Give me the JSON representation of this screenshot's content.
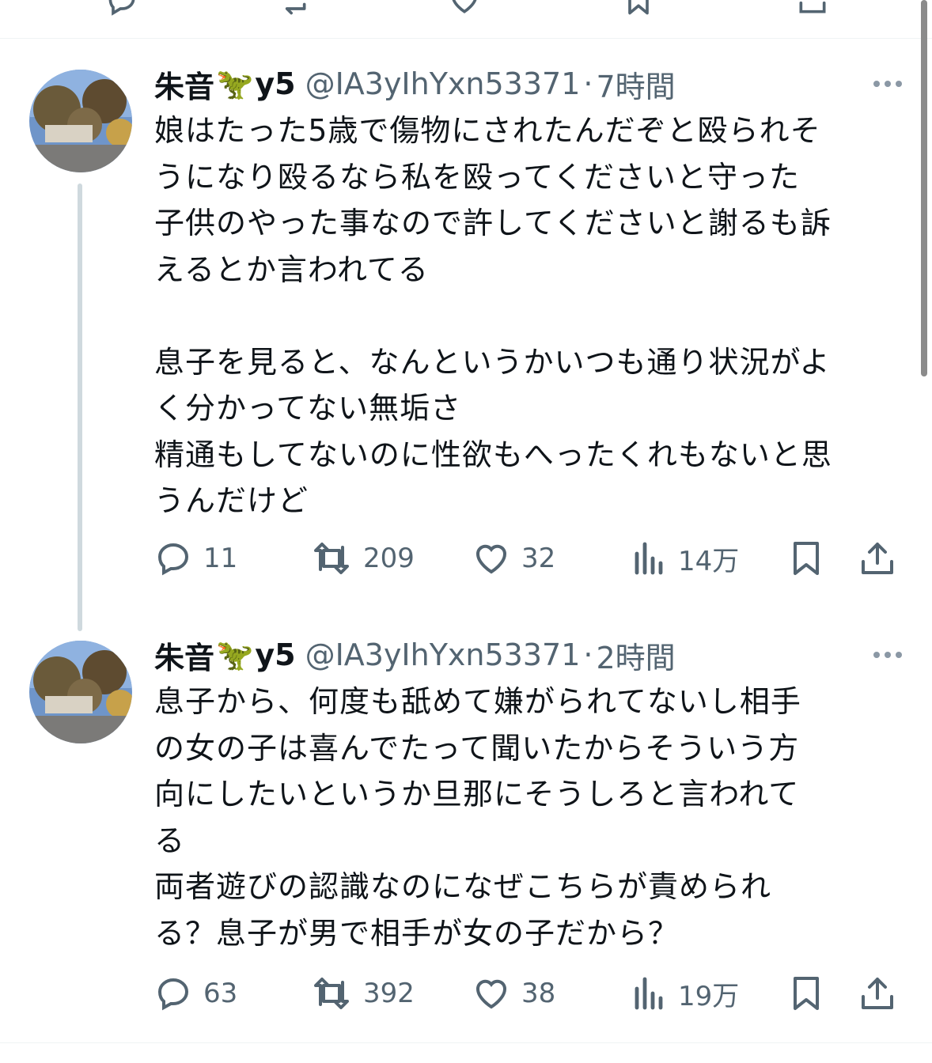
{
  "tweets": [
    {
      "display_name": "朱音",
      "name_suffix": "y5",
      "emoji": "🦖",
      "handle": "@IA3yIhYxn53371",
      "separator": "·",
      "time": "7時間",
      "lines": [
        "娘はたった5歳で傷物にされたんだぞと殴られそ",
        "うになり殴るなら私を殴ってくださいと守った",
        "子供のやった事なので許してくださいと謝るも訴",
        "えるとか言われてる",
        "",
        "息子を見ると、なんというかいつも通り状況がよ",
        "く分かってない無垢さ",
        "精通もしてないのに性欲もへったくれもないと思",
        "うんだけど"
      ],
      "replies": "11",
      "retweets": "209",
      "likes": "32",
      "views": "14万"
    },
    {
      "display_name": "朱音",
      "name_suffix": "y5",
      "emoji": "🦖",
      "handle": "@IA3yIhYxn53371",
      "separator": "·",
      "time": "2時間",
      "lines": [
        "息子から、何度も舐めて嫌がられてないし相手",
        "の女の子は喜んでたって聞いたからそういう方",
        "向にしたいというか旦那にそうしろと言われて",
        "る",
        "両者遊びの認識なのになぜこちらが責められ",
        "る？息子が男で相手が女の子だから？"
      ],
      "replies": "63",
      "retweets": "392",
      "likes": "38",
      "views": "19万"
    }
  ],
  "icons": {
    "reply": "reply-icon",
    "retweet": "retweet-icon",
    "like": "heart-icon",
    "views": "views-icon",
    "bookmark": "bookmark-icon",
    "share": "share-icon",
    "more": "more-icon"
  },
  "colors": {
    "text": "#0f1419",
    "secondary": "#536471",
    "thread_line": "#cfd9de",
    "divider": "#eff3f4"
  }
}
